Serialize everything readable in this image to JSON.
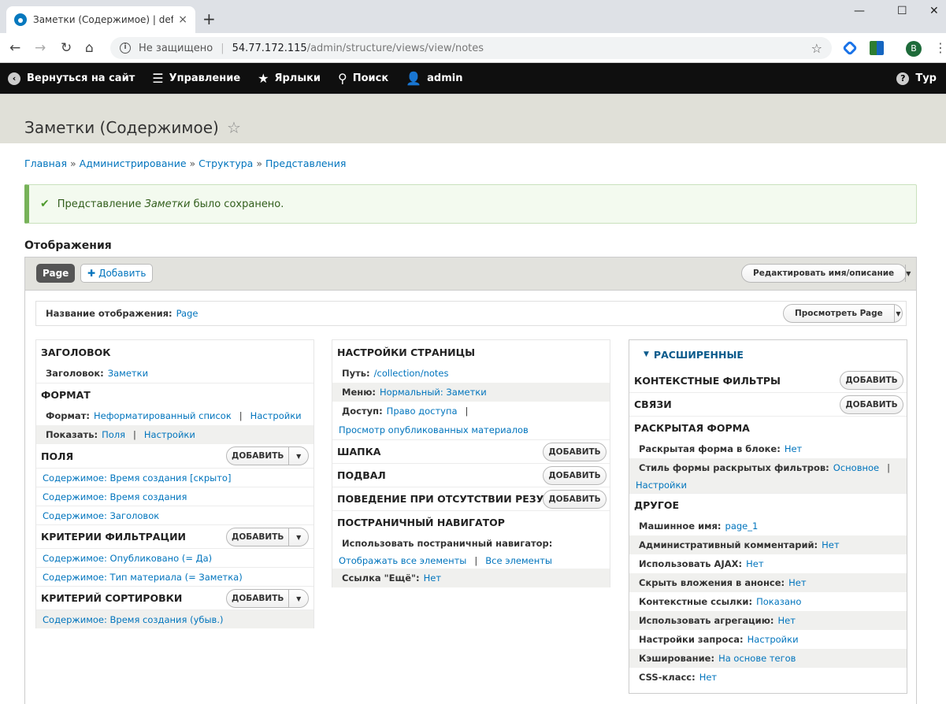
{
  "browser": {
    "tab_title": "Заметки (Содержимое) | default",
    "tab_close": "×",
    "new_tab": "+",
    "insecure": "Не защищено",
    "host": "54.77.172.115",
    "path": "/admin/structure/views/view/notes",
    "avatar": "B"
  },
  "toolbar": {
    "back": "Вернуться на сайт",
    "manage": "Управление",
    "shortcuts": "Ярлыки",
    "search": "Поиск",
    "user": "admin",
    "tour": "Тур"
  },
  "page": {
    "title": "Заметки (Содержимое)",
    "breadcrumb": [
      "Главная",
      "Администрирование",
      "Структура",
      "Представления"
    ],
    "breadcrumb_sep": "»",
    "message_prefix": "Представление ",
    "message_name": "Заметки",
    "message_suffix": " было сохранено.",
    "section": "Отображения"
  },
  "displays": {
    "active": "Page",
    "add": "Добавить",
    "edit_name": "Редактировать имя/описание",
    "name_label": "Название отображения:",
    "name_value": "Page",
    "view_page": "Просмотреть Page"
  },
  "col1": {
    "header_title": "Заголовок",
    "header_label": "Заголовок:",
    "header_value": "Заметки",
    "format_title": "Формат",
    "format_label": "Формат:",
    "format_value": "Неформатированный список",
    "format_settings": "Настройки",
    "show_label": "Показать:",
    "show_value": "Поля",
    "show_settings": "Настройки",
    "fields_title": "Поля",
    "fields": [
      "Содержимое: Время создания [скрыто]",
      "Содержимое: Время создания",
      "Содержимое: Заголовок"
    ],
    "filters_title": "Критерии фильтрации",
    "filters": [
      "Содержимое: Опубликовано (= Да)",
      "Содержимое: Тип материала (= Заметка)"
    ],
    "sort_title": "Критерий сортировки",
    "sorts": [
      "Содержимое: Время создания (убыв.)"
    ],
    "add": "Добавить"
  },
  "col2": {
    "page_settings_title": "Настройки страницы",
    "path_label": "Путь:",
    "path_value": "/collection/notes",
    "menu_label": "Меню:",
    "menu_value": "Нормальный: Заметки",
    "access_label": "Доступ:",
    "access_value": "Право доступа",
    "access_value2": "Просмотр опубликованных материалов",
    "header_title": "Шапка",
    "footer_title": "Подвал",
    "empty_title": "Поведение при отсутствии результатов",
    "pager_title": "Постраничный навигатор",
    "pager_label": "Использовать постраничный навигатор:",
    "pager_value1": "Отображать все элементы",
    "pager_value2": "Все элементы",
    "more_label": "Ссылка \"Ещё\":",
    "more_value": "Нет",
    "add": "Добавить"
  },
  "col3": {
    "advanced": "РАСШИРЕННЫЕ",
    "ctx_title": "Контекстные фильтры",
    "rel_title": "Связи",
    "exposed_title": "Раскрытая форма",
    "exposed_block_label": "Раскрытая форма в блоке:",
    "exposed_block_value": "Нет",
    "exposed_style_label": "Стиль формы раскрытых фильтров:",
    "exposed_style_value": "Основное",
    "exposed_style_settings": "Настройки",
    "other_title": "Другое",
    "machine_label": "Машинное имя:",
    "machine_value": "page_1",
    "admin_label": "Административный комментарий:",
    "admin_value": "Нет",
    "ajax_label": "Использовать AJAX:",
    "ajax_value": "Нет",
    "hide_label": "Скрыть вложения в анонсе:",
    "hide_value": "Нет",
    "ctxlinks_label": "Контекстные ссылки:",
    "ctxlinks_value": "Показано",
    "agg_label": "Использовать агрегацию:",
    "agg_value": "Нет",
    "query_label": "Настройки запроса:",
    "query_value": "Настройки",
    "cache_label": "Кэширование:",
    "cache_value": "На основе тегов",
    "css_label": "CSS-класс:",
    "css_value": "Нет",
    "add": "Добавить"
  }
}
